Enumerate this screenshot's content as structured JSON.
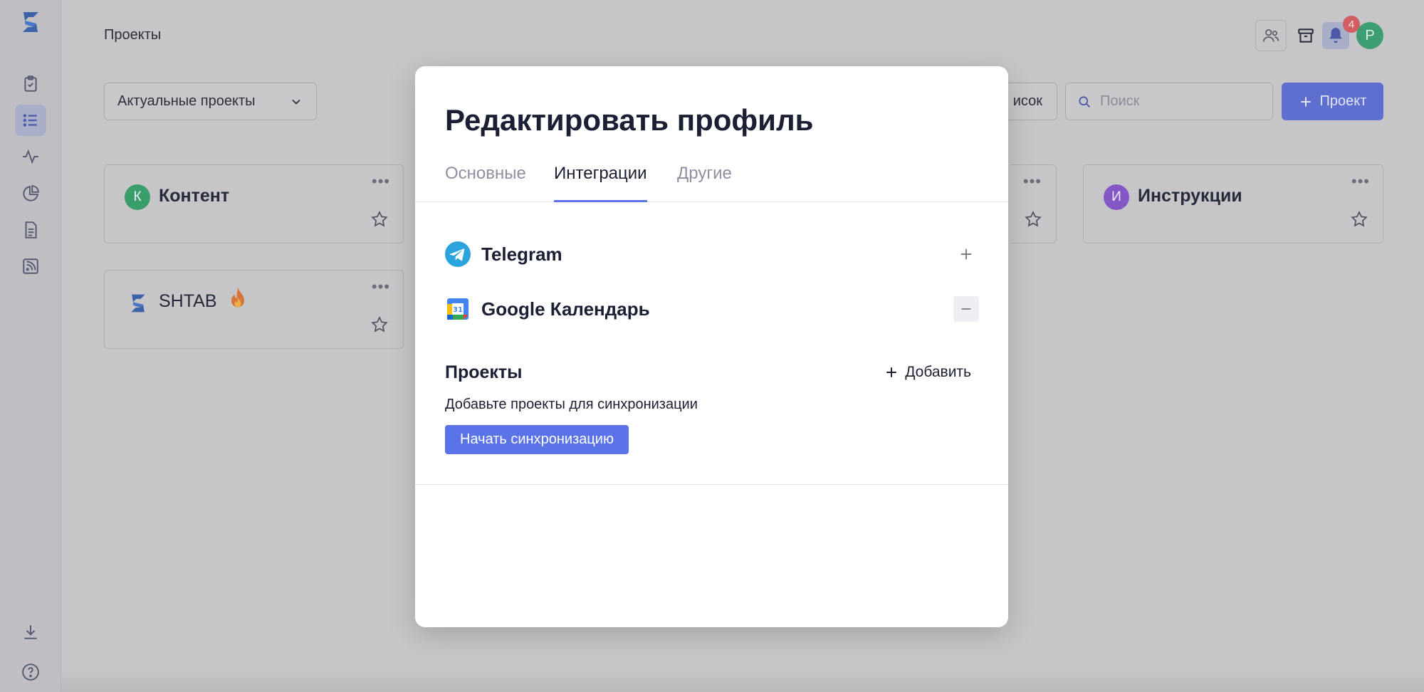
{
  "page": {
    "title": "Проекты"
  },
  "sidebar": {
    "items": [
      {
        "name": "tasks",
        "icon": "clipboard-check-icon"
      },
      {
        "name": "projects",
        "icon": "list-icon",
        "active": true
      },
      {
        "name": "activity",
        "icon": "activity-icon"
      },
      {
        "name": "reports",
        "icon": "pie-chart-icon"
      },
      {
        "name": "documents",
        "icon": "document-icon"
      },
      {
        "name": "feeds",
        "icon": "rss-icon"
      }
    ],
    "bottom": [
      {
        "name": "download",
        "icon": "download-icon"
      },
      {
        "name": "help",
        "icon": "help-icon"
      }
    ]
  },
  "header": {
    "notifications_count": "4",
    "avatar_letter": "Р"
  },
  "toolbar": {
    "filter_value": "Актуальные проекты",
    "list_label": "исок",
    "search_placeholder": "Поиск",
    "project_button": "Проект"
  },
  "cards": [
    {
      "letter": "К",
      "name": "Контент",
      "color": "#3a9e6a"
    },
    {
      "letter": "И",
      "name": "Инструкции",
      "color": "#8457c7"
    },
    {
      "name": "SHTAB"
    }
  ],
  "modal": {
    "title": "Редактировать профиль",
    "tabs": [
      "Основные",
      "Интеграции",
      "Другие"
    ],
    "active_tab": "Интеграции",
    "integrations": [
      {
        "name": "Telegram",
        "action": "add"
      },
      {
        "name": "Google Календарь",
        "action": "remove",
        "icon_text": "31"
      }
    ],
    "projects": {
      "title": "Проекты",
      "add_label": "Добавить",
      "description": "Добавьте проекты для синхронизации",
      "sync_button": "Начать синхронизацию"
    }
  },
  "colors": {
    "accent": "#5b73e8",
    "text_dark": "#1b1f33",
    "tab_inactive": "#8c90a0"
  }
}
